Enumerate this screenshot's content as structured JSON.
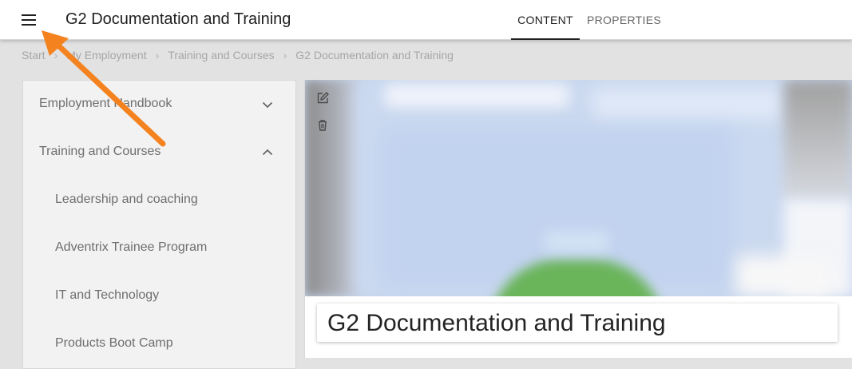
{
  "header": {
    "title": "G2 Documentation and Training",
    "tabs": [
      {
        "label": "CONTENT",
        "active": true
      },
      {
        "label": "PROPERTIES",
        "active": false
      }
    ]
  },
  "breadcrumb": [
    "Start",
    "My Employment",
    "Training and Courses",
    "G2 Documentation and Training"
  ],
  "sidebar": {
    "items": [
      {
        "label": "Employment Handbook",
        "state": "collapsed",
        "icon": "chevron-down-icon"
      },
      {
        "label": "Training and Courses",
        "state": "expanded",
        "icon": "chevron-up-icon"
      },
      {
        "label": "Leadership and coaching"
      },
      {
        "label": "Adventrix Trainee Program"
      },
      {
        "label": "IT and Technology"
      },
      {
        "label": "Products Boot Camp"
      }
    ]
  },
  "content": {
    "toolbar_icons": [
      "edit-icon",
      "trash-icon"
    ],
    "heading": "G2 Documentation and Training"
  },
  "colors": {
    "annotation_arrow": "#f4821f",
    "tab_indicator": "#202020",
    "hero_green": "#6ab45a"
  },
  "icons": {
    "menu": "hamburger-menu-icon"
  }
}
